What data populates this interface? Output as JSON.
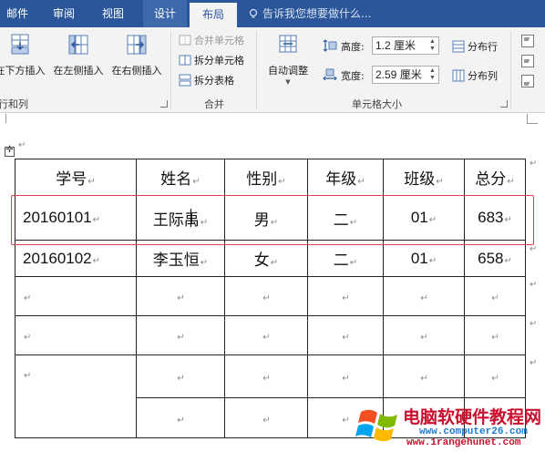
{
  "tabs": [
    {
      "label": "邮件"
    },
    {
      "label": "审阅"
    },
    {
      "label": "视图"
    },
    {
      "label": "设计"
    },
    {
      "label": "布局"
    }
  ],
  "tell_me": {
    "placeholder": "告诉我您想要做什么..."
  },
  "ribbon": {
    "rows_columns": {
      "insert_below": "在下方插入",
      "insert_left": "在左侧插入",
      "insert_right": "在右侧插入",
      "group_label": "行和列"
    },
    "merge": {
      "merge_cells": "合并单元格",
      "split_cells": "拆分单元格",
      "split_table": "拆分表格",
      "group_label": "合并"
    },
    "cell_size": {
      "autofit": "自动调整",
      "height_label": "高度:",
      "height_value": "1.2 厘米",
      "width_label": "宽度:",
      "width_value": "2.59 厘米",
      "distribute_rows": "分布行",
      "distribute_cols": "分布列",
      "group_label": "单元格大小"
    }
  },
  "table": {
    "headers": [
      "学号",
      "姓名",
      "性别",
      "年级",
      "班级",
      "总分"
    ],
    "rows": [
      [
        "20160101",
        "王际禹",
        "男",
        "二",
        "01",
        "683"
      ],
      [
        "20160102",
        "李玉恒",
        "女",
        "二",
        "01",
        "658"
      ]
    ]
  },
  "paragraph_mark": "↵",
  "move_handle_glyph": "✛",
  "watermark": {
    "title": "电脑软硬件教程网",
    "url1": "www.computer26.com",
    "url2": "www.1rangehunet.com"
  },
  "colors": {
    "ribbon_blue": "#2b579a",
    "selection_outline": "#e2404d",
    "watermark_red": "#c8102e",
    "watermark_blue": "#1c7ccf"
  }
}
